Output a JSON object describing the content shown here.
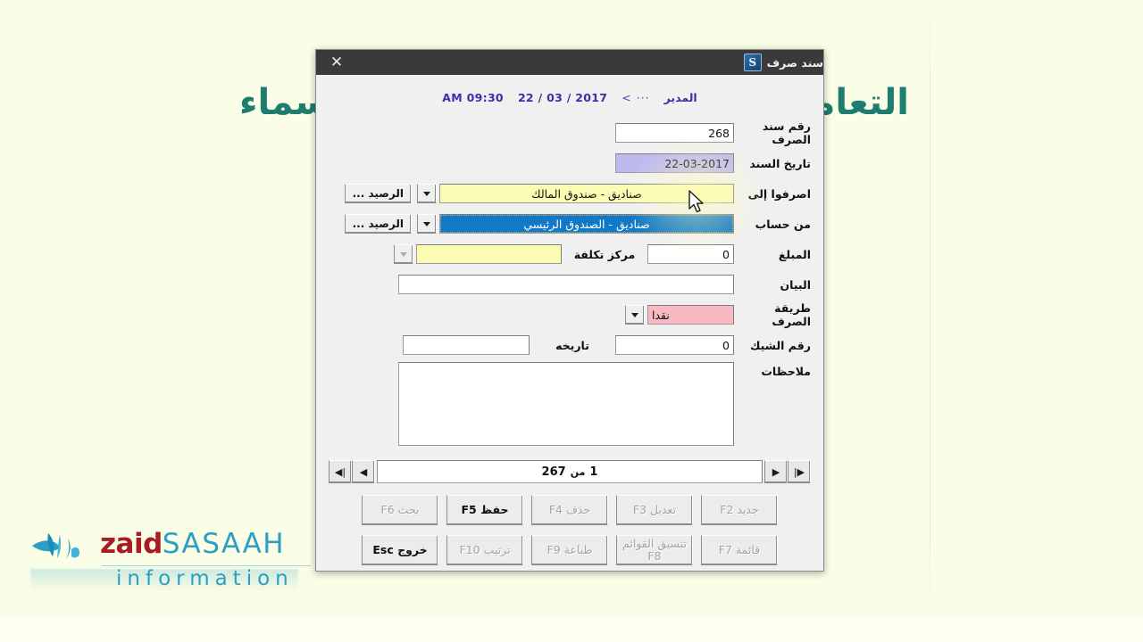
{
  "background": {
    "page_color": "#fbfee6",
    "watermark_right": "التعامل",
    "watermark_left": "لأسماء",
    "watermark_color": "#1e7d6e"
  },
  "logo": {
    "word1": "zaid",
    "word2": "SASAAH",
    "word3": "information",
    "color_word1": "#a81d22",
    "color_word2": "#2e9fc4"
  },
  "dialog": {
    "title": "سند صرف",
    "icon": "app-icon",
    "close_label": "✕",
    "header": {
      "user": "المدير",
      "separator": "··· >",
      "date": "2017 / 03 / 22",
      "time": "AM 09:30"
    }
  },
  "form": {
    "voucher_no": {
      "label": "رقم سند الصرف",
      "value": "268"
    },
    "voucher_date": {
      "label": "تاريخ السند",
      "value": "22-03-2017"
    },
    "pay_to": {
      "label": "اصرفوا إلى",
      "value": "صناديق - صندوق المالك",
      "balance_button": "الرصيد ...",
      "dropdown_icon": "chevron-down-icon"
    },
    "from_account": {
      "label": "من حساب",
      "value": "صناديق - الصندوق الرئيسي",
      "balance_button": "الرصيد ...",
      "dropdown_icon": "chevron-down-icon"
    },
    "amount": {
      "label": "المبلغ",
      "value": "0"
    },
    "cost_center": {
      "label": "مركز تكلفة",
      "value": "",
      "dropdown_icon": "chevron-down-icon"
    },
    "statement": {
      "label": "البيان",
      "value": ""
    },
    "pay_method": {
      "label": "طريقة الصرف",
      "value": "نقدا",
      "dropdown_icon": "chevron-down-icon"
    },
    "cheque_no": {
      "label": "رقم الشيك",
      "value": "0"
    },
    "cheque_date": {
      "label": "تاريخه",
      "value": ""
    },
    "notes": {
      "label": "ملاحظات",
      "value": ""
    }
  },
  "navigator": {
    "first_icon": "first-record-icon",
    "prev_icon": "previous-record-icon",
    "next_icon": "next-record-icon",
    "last_icon": "last-record-icon",
    "current": "1",
    "of": "من",
    "total": "267"
  },
  "actions": {
    "row1": [
      {
        "label": "جديد F2",
        "enabled": false
      },
      {
        "label": "تعديل F3",
        "enabled": false
      },
      {
        "label": "حذف F4",
        "enabled": false
      },
      {
        "label": "حفظ F5",
        "enabled": true
      },
      {
        "label": "بحث F6",
        "enabled": false
      }
    ],
    "row2": [
      {
        "label": "قائمة F7",
        "enabled": false
      },
      {
        "label": "تنسيق القوائم F8",
        "enabled": false
      },
      {
        "label": "طباعة F9",
        "enabled": false
      },
      {
        "label": "ترتيب F10",
        "enabled": false
      },
      {
        "label": "خروج Esc",
        "enabled": true
      }
    ]
  }
}
